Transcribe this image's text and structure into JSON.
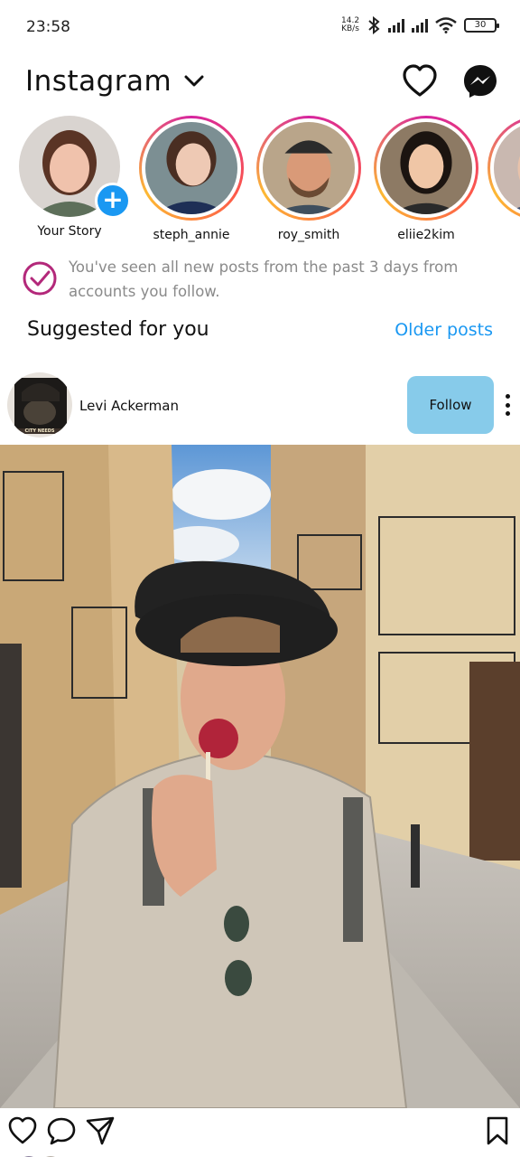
{
  "status_bar": {
    "time": "23:58",
    "net_speed_value": "14.2",
    "net_speed_unit": "KB/s",
    "battery": "30"
  },
  "header": {
    "title": "Instagram"
  },
  "stories": [
    {
      "name": "Your Story"
    },
    {
      "name": "steph_annie"
    },
    {
      "name": "roy_smith"
    },
    {
      "name": "eliie2kim"
    }
  ],
  "notice": {
    "text": "You've seen all new posts from the past 3 days from accounts you follow."
  },
  "suggested": {
    "title": "Suggested for you",
    "older_link": "Older posts"
  },
  "post": {
    "username": "Levi Ackerman",
    "follow_label": "Follow",
    "avatar_caption": "CITY NEEDS"
  },
  "colors": {
    "accent": "#1a98f2",
    "follow_bg": "#87cbea",
    "story_ring": "#d6249f",
    "muted_text": "#8a8a8a"
  },
  "icons": {
    "header": [
      "chevron-down-icon",
      "heart-icon",
      "messenger-icon"
    ],
    "actions": [
      "heart-icon",
      "comment-icon",
      "share-icon",
      "bookmark-icon"
    ]
  }
}
